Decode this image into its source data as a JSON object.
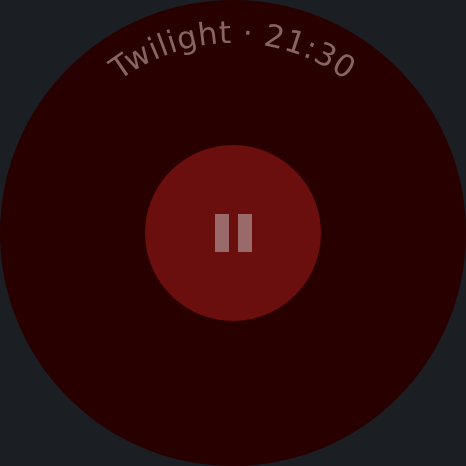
{
  "colors": {
    "background": "#1b1e22",
    "face": "#280000",
    "button": "#6a0e0e",
    "icon": "#9a6a6a",
    "title_text": "#8a6464"
  },
  "title": {
    "text": "Twilight · 21:30"
  },
  "control": {
    "state": "playing",
    "icon": "pause-icon"
  }
}
